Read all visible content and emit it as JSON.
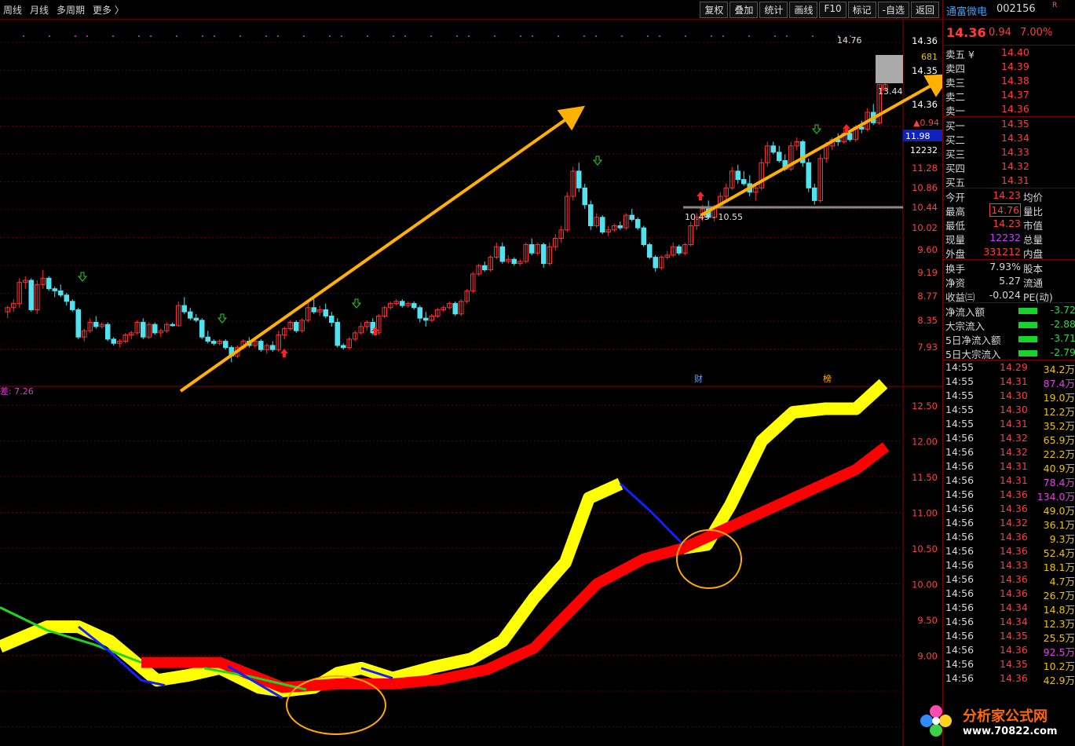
{
  "toolbar": {
    "left": [
      "周线",
      "月线",
      "多周期",
      "更多 〉"
    ],
    "right": [
      "复权",
      "叠加",
      "统计",
      "画线",
      "F10",
      "标记",
      "-自选",
      "返回"
    ]
  },
  "stock": {
    "name": "通富微电",
    "code": "002156",
    "tag": "R",
    "price": "14.36",
    "change": "0.94",
    "pct": "7.00%"
  },
  "order_book": {
    "sell": [
      {
        "label": "卖五 ¥",
        "price": "14.40"
      },
      {
        "label": "卖四",
        "price": "14.39"
      },
      {
        "label": "卖三",
        "price": "14.38"
      },
      {
        "label": "卖二",
        "price": "14.37"
      },
      {
        "label": "卖一",
        "price": "14.36"
      }
    ],
    "buy": [
      {
        "label": "买一",
        "price": "14.35"
      },
      {
        "label": "买二",
        "price": "14.34"
      },
      {
        "label": "买三",
        "price": "14.33"
      },
      {
        "label": "买四",
        "price": "14.32"
      },
      {
        "label": "买五",
        "price": "14.31"
      }
    ]
  },
  "quote": [
    {
      "l": "今开",
      "v": "14.23",
      "l2": "均价",
      "color": "#ff3b3b"
    },
    {
      "l": "最高",
      "v": "14.76",
      "l2": "量比",
      "color": "#ff3b3b",
      "boxed": true
    },
    {
      "l": "最低",
      "v": "14.23",
      "l2": "市值",
      "color": "#ff3b3b"
    },
    {
      "l": "现量",
      "v": "12232",
      "l2": "总量",
      "color": "#c040ff"
    },
    {
      "l": "外盘",
      "v": "331212",
      "l2": "内盘",
      "color": "#ff3b3b"
    }
  ],
  "fundamentals": [
    {
      "l": "换手",
      "v": "7.93%",
      "l2": "股本"
    },
    {
      "l": "净资",
      "v": "5.27",
      "l2": "流通"
    },
    {
      "l": "收益㈢",
      "v": "-0.024",
      "l2": "PE(动)"
    }
  ],
  "flows": [
    {
      "l": "净流入额",
      "v": "-3.72"
    },
    {
      "l": "大宗流入",
      "v": "-2.88"
    },
    {
      "l": "5日净流入额",
      "v": "-3.71"
    },
    {
      "l": "5日大宗流入",
      "v": "-2.79"
    }
  ],
  "ticks": [
    {
      "t": "14:55",
      "p": "14.29",
      "q": "34.2万"
    },
    {
      "t": "14:55",
      "p": "14.31",
      "q": "87.4万",
      "m": true
    },
    {
      "t": "14:55",
      "p": "14.30",
      "q": "19.0万"
    },
    {
      "t": "14:55",
      "p": "14.30",
      "q": "12.2万"
    },
    {
      "t": "14:55",
      "p": "14.31",
      "q": "35.2万"
    },
    {
      "t": "14:56",
      "p": "14.32",
      "q": "65.9万"
    },
    {
      "t": "14:56",
      "p": "14.32",
      "q": "22.2万"
    },
    {
      "t": "14:56",
      "p": "14.31",
      "q": "40.9万"
    },
    {
      "t": "14:56",
      "p": "14.31",
      "q": "78.4万",
      "m": true
    },
    {
      "t": "14:56",
      "p": "14.36",
      "q": "134.0万",
      "m": true
    },
    {
      "t": "14:56",
      "p": "14.36",
      "q": "49.0万"
    },
    {
      "t": "14:56",
      "p": "14.32",
      "q": "36.1万"
    },
    {
      "t": "14:56",
      "p": "14.36",
      "q": "9.3万"
    },
    {
      "t": "14:56",
      "p": "14.36",
      "q": "52.4万"
    },
    {
      "t": "14:56",
      "p": "14.33",
      "q": "18.1万"
    },
    {
      "t": "14:56",
      "p": "14.36",
      "q": "4.7万"
    },
    {
      "t": "14:56",
      "p": "14.36",
      "q": "26.7万"
    },
    {
      "t": "14:56",
      "p": "14.34",
      "q": "14.8万"
    },
    {
      "t": "14:56",
      "p": "14.34",
      "q": "12.3万"
    },
    {
      "t": "14:56",
      "p": "14.35",
      "q": "25.5万"
    },
    {
      "t": "14:56",
      "p": "14.36",
      "q": "92.5万",
      "m": true
    },
    {
      "t": "14:56",
      "p": "14.35",
      "q": "10.2万"
    },
    {
      "t": "14:56",
      "p": "14.36",
      "q": "42.9万"
    }
  ],
  "price_axis": {
    "ticks": [
      "14.36",
      "14.35",
      "14.36",
      "11.28",
      "10.86",
      "10.44",
      "10.02",
      "9.60",
      "9.19",
      "8.77",
      "8.35",
      "7.93"
    ],
    "extra": {
      "vol": "681",
      "vol2": "12232",
      "chg": "▲0.94",
      "cur": "11.98"
    }
  },
  "indicator_axis": {
    "ticks": [
      "12.50",
      "12.00",
      "11.50",
      "11.00",
      "10.50",
      "10.00",
      "9.50",
      "9.00"
    ]
  },
  "annotations": {
    "high": "14.76",
    "low": "13.44",
    "range": "10.49 - 10.55",
    "ind_label": "差: 7.26",
    "cai": "财",
    "bang": "榜"
  },
  "watermark": {
    "title": "分析家公式网",
    "url": "www.70822.com"
  },
  "colors": {
    "up": "#ff3030",
    "down": "#4fe3f0",
    "ma_yellow": "#ffff00",
    "ma_red": "#ff0000",
    "blue": "#1020ff",
    "green": "#22d322",
    "arrow": "#ffb000"
  },
  "candles": [
    [
      8.95,
      9.1,
      8.8,
      9.05
    ],
    [
      9.05,
      9.25,
      8.95,
      9.15
    ],
    [
      9.15,
      9.75,
      9.05,
      9.65
    ],
    [
      9.65,
      9.8,
      9.5,
      9.7
    ],
    [
      9.7,
      9.75,
      8.95,
      9.0
    ],
    [
      9.0,
      9.7,
      8.9,
      9.6
    ],
    [
      9.6,
      9.95,
      9.5,
      9.75
    ],
    [
      9.75,
      9.8,
      9.45,
      9.5
    ],
    [
      9.5,
      9.55,
      9.3,
      9.45
    ],
    [
      9.45,
      9.6,
      9.3,
      9.35
    ],
    [
      9.35,
      9.4,
      9.1,
      9.2
    ],
    [
      9.2,
      9.25,
      8.95,
      9.0
    ],
    [
      9.0,
      9.05,
      8.3,
      8.35
    ],
    [
      8.35,
      8.55,
      8.25,
      8.5
    ],
    [
      8.5,
      8.8,
      8.45,
      8.7
    ],
    [
      8.7,
      8.85,
      8.55,
      8.6
    ],
    [
      8.6,
      8.7,
      8.55,
      8.65
    ],
    [
      8.65,
      8.7,
      8.25,
      8.3
    ],
    [
      8.3,
      8.35,
      8.15,
      8.2
    ],
    [
      8.2,
      8.3,
      8.1,
      8.25
    ],
    [
      8.25,
      8.45,
      8.2,
      8.4
    ],
    [
      8.4,
      8.5,
      8.3,
      8.45
    ],
    [
      8.45,
      8.75,
      8.4,
      8.7
    ],
    [
      8.7,
      8.8,
      8.3,
      8.35
    ],
    [
      8.35,
      8.7,
      8.3,
      8.65
    ],
    [
      8.65,
      8.7,
      8.4,
      8.45
    ],
    [
      8.45,
      8.55,
      8.35,
      8.5
    ],
    [
      8.5,
      8.7,
      8.45,
      8.65
    ],
    [
      8.65,
      8.7,
      8.6,
      8.62
    ],
    [
      8.62,
      9.2,
      8.6,
      9.1
    ],
    [
      9.1,
      9.3,
      8.9,
      8.95
    ],
    [
      8.95,
      9.05,
      8.75,
      8.8
    ],
    [
      8.8,
      8.9,
      8.7,
      8.75
    ],
    [
      8.75,
      8.8,
      8.3,
      8.35
    ],
    [
      8.35,
      8.5,
      8.2,
      8.25
    ],
    [
      8.25,
      8.3,
      8.15,
      8.2
    ],
    [
      8.2,
      8.3,
      8.15,
      8.25
    ],
    [
      8.25,
      8.3,
      8.05,
      8.1
    ],
    [
      8.1,
      8.15,
      7.75,
      7.9
    ],
    [
      7.9,
      8.15,
      7.85,
      8.1
    ],
    [
      8.1,
      8.3,
      8.05,
      8.25
    ],
    [
      8.25,
      8.35,
      8.1,
      8.15
    ],
    [
      8.15,
      8.3,
      8.1,
      8.25
    ],
    [
      8.25,
      8.3,
      8.0,
      8.05
    ],
    [
      8.05,
      8.2,
      7.95,
      8.15
    ],
    [
      8.15,
      8.25,
      8.0,
      8.05
    ],
    [
      8.05,
      8.5,
      8.0,
      8.4
    ],
    [
      8.4,
      8.6,
      8.3,
      8.55
    ],
    [
      8.55,
      8.75,
      8.5,
      8.7
    ],
    [
      8.7,
      8.75,
      8.45,
      8.5
    ],
    [
      8.5,
      8.8,
      8.45,
      8.75
    ],
    [
      8.75,
      9.2,
      8.7,
      9.05
    ],
    [
      9.05,
      9.3,
      8.9,
      8.95
    ],
    [
      8.95,
      9.1,
      8.85,
      9.0
    ],
    [
      9.0,
      9.15,
      8.8,
      8.85
    ],
    [
      8.85,
      8.95,
      8.6,
      8.7
    ],
    [
      8.7,
      8.8,
      8.1,
      8.15
    ],
    [
      8.15,
      8.2,
      8.05,
      8.1
    ],
    [
      8.1,
      8.35,
      8.05,
      8.3
    ],
    [
      8.3,
      8.5,
      8.25,
      8.45
    ],
    [
      8.45,
      8.7,
      8.4,
      8.6
    ],
    [
      8.6,
      8.75,
      8.5,
      8.7
    ],
    [
      8.7,
      8.8,
      8.4,
      8.45
    ],
    [
      8.45,
      8.9,
      8.4,
      8.85
    ],
    [
      8.85,
      9.1,
      8.8,
      9.05
    ],
    [
      9.05,
      9.2,
      9.0,
      9.15
    ],
    [
      9.15,
      9.25,
      9.1,
      9.2
    ],
    [
      9.2,
      9.25,
      9.05,
      9.1
    ],
    [
      9.1,
      9.2,
      9.05,
      9.15
    ],
    [
      9.15,
      9.2,
      9.0,
      9.05
    ],
    [
      9.05,
      9.1,
      8.7,
      8.8
    ],
    [
      8.8,
      8.95,
      8.6,
      8.75
    ],
    [
      8.75,
      8.9,
      8.7,
      8.85
    ],
    [
      8.85,
      9.05,
      8.8,
      9.0
    ],
    [
      9.0,
      9.1,
      8.95,
      9.05
    ],
    [
      9.05,
      9.2,
      9.0,
      9.15
    ],
    [
      9.15,
      9.2,
      8.85,
      8.9
    ],
    [
      8.9,
      9.25,
      8.85,
      9.2
    ],
    [
      9.2,
      9.5,
      9.15,
      9.45
    ],
    [
      9.45,
      9.9,
      9.4,
      9.85
    ],
    [
      9.85,
      10.1,
      9.8,
      10.05
    ],
    [
      10.05,
      10.15,
      9.9,
      9.95
    ],
    [
      9.95,
      10.3,
      9.9,
      10.25
    ],
    [
      10.25,
      10.6,
      10.2,
      10.5
    ],
    [
      10.5,
      10.6,
      10.1,
      10.15
    ],
    [
      10.15,
      10.3,
      10.1,
      10.2
    ],
    [
      10.2,
      10.25,
      10.05,
      10.1
    ],
    [
      10.1,
      10.2,
      10.05,
      10.15
    ],
    [
      10.15,
      10.6,
      10.1,
      10.55
    ],
    [
      10.55,
      10.7,
      10.3,
      10.35
    ],
    [
      10.35,
      10.6,
      10.3,
      10.55
    ],
    [
      10.55,
      10.6,
      10.0,
      10.1
    ],
    [
      10.1,
      10.6,
      10.05,
      10.5
    ],
    [
      10.5,
      10.8,
      10.4,
      10.7
    ],
    [
      10.7,
      11.0,
      10.6,
      10.9
    ],
    [
      10.9,
      11.8,
      10.85,
      11.7
    ],
    [
      11.7,
      12.4,
      11.6,
      12.3
    ],
    [
      12.3,
      12.5,
      11.8,
      11.9
    ],
    [
      11.9,
      12.0,
      11.4,
      11.5
    ],
    [
      11.5,
      11.6,
      10.9,
      11.0
    ],
    [
      11.0,
      11.3,
      10.95,
      11.2
    ],
    [
      11.2,
      11.25,
      10.8,
      10.85
    ],
    [
      10.85,
      11.0,
      10.75,
      10.9
    ],
    [
      10.9,
      11.05,
      10.85,
      11.0
    ],
    [
      11.0,
      11.1,
      10.9,
      10.95
    ],
    [
      10.95,
      11.3,
      10.9,
      11.25
    ],
    [
      11.25,
      11.4,
      11.1,
      11.15
    ],
    [
      11.15,
      11.2,
      10.9,
      10.95
    ],
    [
      10.95,
      11.0,
      10.5,
      10.55
    ],
    [
      10.55,
      10.6,
      10.2,
      10.25
    ],
    [
      10.25,
      10.3,
      9.9,
      10.0
    ],
    [
      10.0,
      10.3,
      9.95,
      10.25
    ],
    [
      10.25,
      10.4,
      10.2,
      10.3
    ],
    [
      10.3,
      10.6,
      10.25,
      10.5
    ],
    [
      10.5,
      10.55,
      10.3,
      10.35
    ],
    [
      10.35,
      10.6,
      10.3,
      10.55
    ],
    [
      10.55,
      11.1,
      10.5,
      11.0
    ],
    [
      11.0,
      11.3,
      10.9,
      11.2
    ],
    [
      11.2,
      11.5,
      11.1,
      11.4
    ],
    [
      11.4,
      11.6,
      11.15,
      11.2
    ],
    [
      11.2,
      11.5,
      11.1,
      11.45
    ],
    [
      11.45,
      11.8,
      11.4,
      11.7
    ],
    [
      11.7,
      12.0,
      11.6,
      11.9
    ],
    [
      11.9,
      12.4,
      11.85,
      12.3
    ],
    [
      12.3,
      12.45,
      12.0,
      12.1
    ],
    [
      12.1,
      12.3,
      11.95,
      12.0
    ],
    [
      12.0,
      12.2,
      11.7,
      11.8
    ],
    [
      11.8,
      12.0,
      11.6,
      11.9
    ],
    [
      11.9,
      12.6,
      11.85,
      12.5
    ],
    [
      12.5,
      13.0,
      12.4,
      12.9
    ],
    [
      12.9,
      13.0,
      12.7,
      12.75
    ],
    [
      12.75,
      12.9,
      12.5,
      12.55
    ],
    [
      12.55,
      12.7,
      12.3,
      12.35
    ],
    [
      12.35,
      13.0,
      12.3,
      12.9
    ],
    [
      12.9,
      13.1,
      12.8,
      13.0
    ],
    [
      13.0,
      13.05,
      12.4,
      12.5
    ],
    [
      12.5,
      12.6,
      11.8,
      11.9
    ],
    [
      11.9,
      12.0,
      11.5,
      11.6
    ],
    [
      11.6,
      12.7,
      11.55,
      12.6
    ],
    [
      12.6,
      13.0,
      12.5,
      12.9
    ],
    [
      12.9,
      13.1,
      12.8,
      13.05
    ],
    [
      13.05,
      13.2,
      12.9,
      13.0
    ],
    [
      13.0,
      13.3,
      12.95,
      13.2
    ],
    [
      13.2,
      13.25,
      13.0,
      13.05
    ],
    [
      13.05,
      13.4,
      13.0,
      13.35
    ],
    [
      13.35,
      13.5,
      13.2,
      13.3
    ],
    [
      13.3,
      13.8,
      13.25,
      13.7
    ],
    [
      13.7,
      13.9,
      13.4,
      13.45
    ],
    [
      13.45,
      14.36,
      13.4,
      14.36
    ],
    [
      14.23,
      14.76,
      14.23,
      14.36
    ]
  ]
}
